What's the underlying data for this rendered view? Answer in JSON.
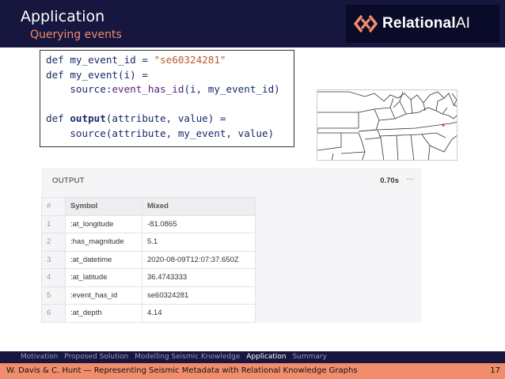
{
  "header": {
    "title": "Application",
    "subtitle": "Querying events",
    "logo_brand": "Relational",
    "logo_suffix": "AI"
  },
  "code": {
    "line1": {
      "kw": "def",
      "name": "my_event_id",
      "op": " = ",
      "str": "\"se60324281\""
    },
    "line2": {
      "kw": "def",
      "name": "my_event(i)",
      "op": " ="
    },
    "line3": {
      "source": "source",
      "colon": ":",
      "rel": "event_has_id",
      "args": "(i, my_event_id)"
    },
    "line5": {
      "kw": "def",
      "name": "output",
      "args": "(attribute, value) ="
    },
    "line6": {
      "source": "source",
      "args": "(attribute, my_event, value)"
    }
  },
  "output": {
    "title": "OUTPUT",
    "time": "0.70s",
    "more": "···",
    "columns": [
      "#",
      "Symbol",
      "Mixed"
    ],
    "rows": [
      {
        "n": "1",
        "symbol": ":at_longitude",
        "value": "-81.0865"
      },
      {
        "n": "2",
        "symbol": ":has_magnitude",
        "value": "5.1"
      },
      {
        "n": "3",
        "symbol": ":at_datetime",
        "value": "2020-08-09T12:07:37.650Z"
      },
      {
        "n": "4",
        "symbol": ":at_latitude",
        "value": "36.4743333"
      },
      {
        "n": "5",
        "symbol": ":event_has_id",
        "value": "se60324281"
      },
      {
        "n": "6",
        "symbol": ":at_depth",
        "value": "4.14"
      }
    ]
  },
  "nav": {
    "items": [
      "Motivation",
      "Proposed Solution",
      "Modelling Seismic Knowledge",
      "Application",
      "Summary"
    ],
    "active": "Application"
  },
  "footer": {
    "text": "W. Davis & C. Hunt — Representing Seismic Metadata with Relational Knowledge Graphs",
    "page": "17"
  },
  "colors": {
    "header_bg": "#16163f",
    "accent": "#f08d6c",
    "marker": "#e0303a"
  }
}
